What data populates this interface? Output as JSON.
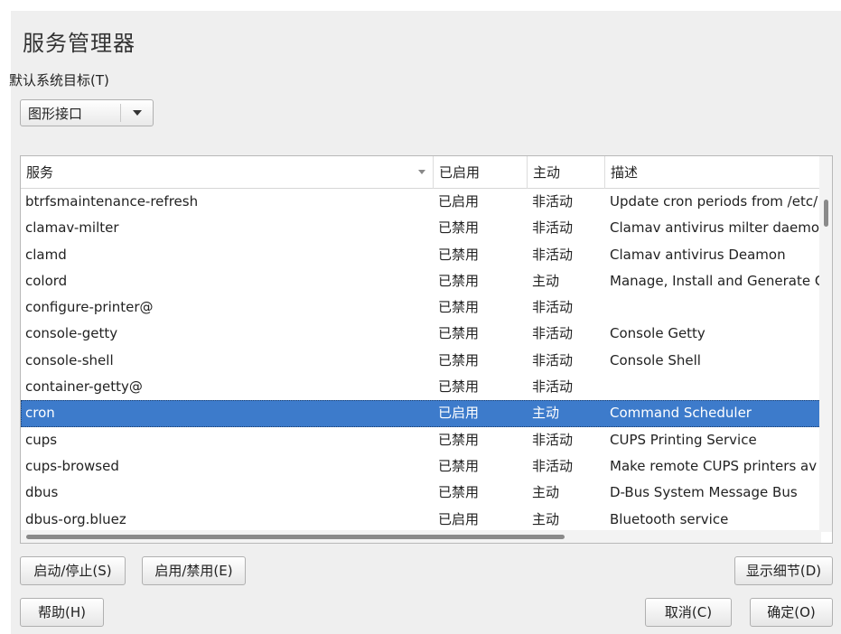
{
  "window": {
    "title": "服务管理器"
  },
  "target": {
    "label": "默认系统目标(T)",
    "selected": "图形接口"
  },
  "table": {
    "headers": [
      "服务",
      "已启用",
      "主动",
      "描述"
    ],
    "rows": [
      [
        "btrfsmaintenance-refresh",
        "已启用",
        "非活动",
        "Update cron periods from /etc/"
      ],
      [
        "clamav-milter",
        "已禁用",
        "非活动",
        "Clamav antivirus milter daemon"
      ],
      [
        "clamd",
        "已禁用",
        "非活动",
        "Clamav antivirus Deamon"
      ],
      [
        "colord",
        "已禁用",
        "主动",
        "Manage, Install and Generate C"
      ],
      [
        "configure-printer@",
        "已禁用",
        "非活动",
        ""
      ],
      [
        "console-getty",
        "已禁用",
        "非活动",
        "Console Getty"
      ],
      [
        "console-shell",
        "已禁用",
        "非活动",
        "Console Shell"
      ],
      [
        "container-getty@",
        "已禁用",
        "非活动",
        ""
      ],
      [
        "cron",
        "已启用",
        "主动",
        "Command Scheduler"
      ],
      [
        "cups",
        "已禁用",
        "非活动",
        "CUPS Printing Service"
      ],
      [
        "cups-browsed",
        "已禁用",
        "非活动",
        "Make remote CUPS printers av"
      ],
      [
        "dbus",
        "已禁用",
        "主动",
        "D-Bus System Message Bus"
      ],
      [
        "dbus-org.bluez",
        "已启用",
        "主动",
        "Bluetooth service"
      ]
    ],
    "selected_index": 8
  },
  "buttons": {
    "start_stop": "启动/停止(S)",
    "enable_disable": "启用/禁用(E)",
    "show_details": "显示细节(D)",
    "help": "帮助(H)",
    "cancel": "取消(C)",
    "ok": "确定(O)"
  },
  "colors": {
    "selection": "#3d7bcb",
    "window_bg": "#efefef"
  }
}
